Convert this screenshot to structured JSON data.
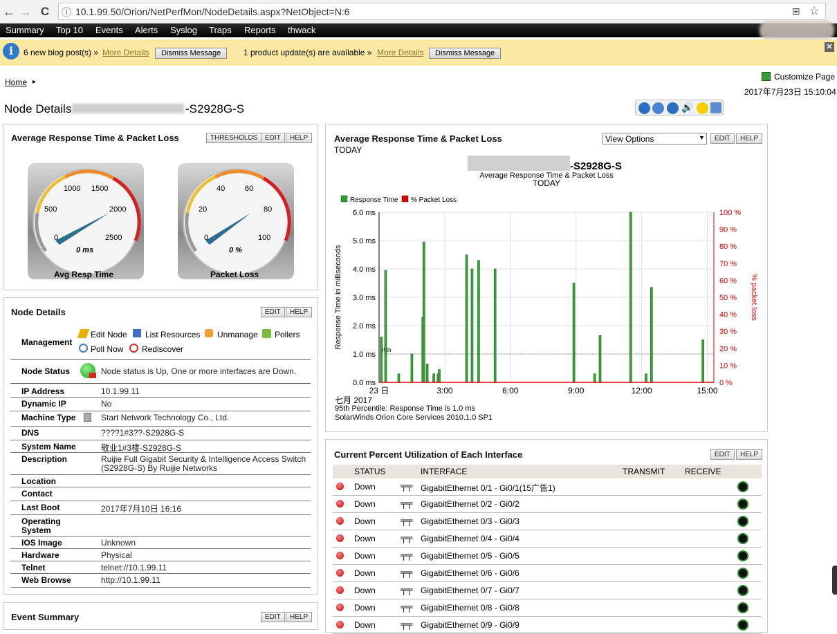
{
  "browser": {
    "url": "10.1.99.50/Orion/NetPerfMon/NodeDetails.aspx?NetObject=N:6",
    "back": "←",
    "forward": "→",
    "reload": "C",
    "info": "ⓘ",
    "star": "☆",
    "translate": "⊞"
  },
  "menu": [
    "Summary",
    "Top 10",
    "Events",
    "Alerts",
    "Syslog",
    "Traps",
    "Reports",
    "thwack"
  ],
  "notice": {
    "blog_text": "6 new blog post(s) »",
    "blog_link": "More Details",
    "dismiss": "Dismiss Message",
    "update_text": "1 product update(s) are available »",
    "update_link": "More Details",
    "close": "✕"
  },
  "header": {
    "home": "Home",
    "arrow": "▸",
    "customize": "Customize Page",
    "datetime": "2017年7月23日 15:10:04",
    "title": "Node Details",
    "title_suffix": "-S2928G-S"
  },
  "gauges_panel": {
    "title": "Average Response Time & Packet Loss",
    "buttons": [
      "THRESHOLDS",
      "EDIT",
      "HELP"
    ],
    "gauges": [
      {
        "caption": "Avg Resp Time",
        "value": "0 ms",
        "ticks": [
          "0",
          "500",
          "1000",
          "1500",
          "2000",
          "2500"
        ]
      },
      {
        "caption": "Packet Loss",
        "value": "0 %",
        "ticks": [
          "0",
          "20",
          "40",
          "60",
          "80",
          "100"
        ]
      }
    ]
  },
  "node_details": {
    "title": "Node Details",
    "buttons": [
      "EDIT",
      "HELP"
    ],
    "management_label": "Management",
    "management": [
      "Edit Node",
      "List Resources",
      "Unmanage",
      "Pollers",
      "Poll Now",
      "Rediscover"
    ],
    "status_label": "Node Status",
    "status": "Node status is Up, One or more interfaces are Down.",
    "rows": [
      {
        "label": "IP Address",
        "value": "10.1.99.11"
      },
      {
        "label": "Dynamic IP",
        "value": "No"
      },
      {
        "label": "Machine Type",
        "value": "Start Network Technology Co., Ltd."
      },
      {
        "label": "DNS",
        "value": "????1#3??-S2928G-S"
      },
      {
        "label": "System Name",
        "value": "敬业1#3楼-S2928G-S"
      },
      {
        "label": "Description",
        "value": "Ruijie Full Gigabit Security & Intelligence Access Switch",
        "value2": "(S2928G-S) By Ruijie Networks"
      },
      {
        "label": "Location",
        "value": ""
      },
      {
        "label": "Contact",
        "value": ""
      },
      {
        "label": "Last Boot",
        "value": "2017年7月10日 16:16"
      },
      {
        "label": "Operating",
        "label2": "System",
        "value": ""
      },
      {
        "label": "IOS Image",
        "value": "Unknown"
      },
      {
        "label": "Hardware",
        "value": "Physical"
      },
      {
        "label": "Telnet",
        "value": "telnet://10.1.99.11"
      },
      {
        "label": "Web Browse",
        "value": "http://10.1.99.11"
      }
    ]
  },
  "event_summary": {
    "title": "Event Summary",
    "buttons": [
      "EDIT",
      "HELP"
    ]
  },
  "chart_panel": {
    "title": "Average Response Time & Packet Loss",
    "subtitle": "TODAY",
    "view_options": "View Options",
    "buttons": [
      "EDIT",
      "HELP"
    ],
    "footer": [
      "七月 2017",
      "95th Percentile: Response Time is 1.0  ms",
      "SolarWinds Orion Core Services 2010.1.0 SP1"
    ]
  },
  "chart_data": {
    "type": "bar",
    "title": "-S2928G-S",
    "subtitle": "Average Response Time & Packet Loss",
    "subtitle2": "TODAY",
    "ylabel": "Response Time in milliseconds",
    "y2label": "% packet loss",
    "ylim": [
      0,
      6
    ],
    "y2lim": [
      0,
      100
    ],
    "yticks": [
      "0.0 ms",
      "1.0 ms",
      "2.0 ms",
      "3.0 ms",
      "4.0 ms",
      "5.0 ms",
      "6.0 ms"
    ],
    "y2ticks": [
      "0 %",
      "10 %",
      "20 %",
      "30 %",
      "40 %",
      "50 %",
      "60 %",
      "70 %",
      "80 %",
      "90 %",
      "100 %"
    ],
    "xlim": [
      0,
      15.3
    ],
    "xticks": [
      {
        "x": 0,
        "label": "23 日"
      },
      {
        "x": 3,
        "label": "3:00"
      },
      {
        "x": 6,
        "label": "6:00"
      },
      {
        "x": 9,
        "label": "9:00"
      },
      {
        "x": 12,
        "label": "12:00"
      },
      {
        "x": 15,
        "label": "15:00"
      }
    ],
    "percentile_label": "95th",
    "percentile_value": 1.0,
    "legend": [
      {
        "name": "Response Time",
        "color": "#2ea12e"
      },
      {
        "name": "% Packet Loss",
        "color": "#e00000"
      }
    ],
    "series": [
      {
        "name": "Response Time",
        "points": [
          [
            0.1,
            1.6
          ],
          [
            0.3,
            3.95
          ],
          [
            0.9,
            0.3
          ],
          [
            1.5,
            1.0
          ],
          [
            2.0,
            2.3
          ],
          [
            2.05,
            4.95
          ],
          [
            2.2,
            0.65
          ],
          [
            2.5,
            0.3
          ],
          [
            2.7,
            0.3
          ],
          [
            2.75,
            0.45
          ],
          [
            4.0,
            4.5
          ],
          [
            4.25,
            4.0
          ],
          [
            4.55,
            4.3
          ],
          [
            5.3,
            4.0
          ],
          [
            8.9,
            3.5
          ],
          [
            9.85,
            0.3
          ],
          [
            10.1,
            1.65
          ],
          [
            11.5,
            6.0
          ],
          [
            12.2,
            0.3
          ],
          [
            12.45,
            3.35
          ],
          [
            14.8,
            1.5
          ]
        ]
      },
      {
        "name": "% Packet Loss",
        "points": [
          [
            0,
            0
          ],
          [
            15.3,
            0
          ]
        ]
      }
    ]
  },
  "iface_panel": {
    "title": "Current Percent Utilization of Each Interface",
    "buttons": [
      "EDIT",
      "HELP"
    ],
    "columns": [
      "STATUS",
      "INTERFACE",
      "TRANSMIT",
      "RECEIVE"
    ],
    "rows": [
      {
        "status": "Down",
        "name": "GigabitEthernet 0/1 - Gi0/1(15广告1)"
      },
      {
        "status": "Down",
        "name": "GigabitEthernet 0/2 - Gi0/2"
      },
      {
        "status": "Down",
        "name": "GigabitEthernet 0/3 - Gi0/3"
      },
      {
        "status": "Down",
        "name": "GigabitEthernet 0/4 - Gi0/4"
      },
      {
        "status": "Down",
        "name": "GigabitEthernet 0/5 - Gi0/5"
      },
      {
        "status": "Down",
        "name": "GigabitEthernet 0/6 - Gi0/6"
      },
      {
        "status": "Down",
        "name": "GigabitEthernet 0/7 - Gi0/7"
      },
      {
        "status": "Down",
        "name": "GigabitEthernet 0/8 - Gi0/8"
      },
      {
        "status": "Down",
        "name": "GigabitEthernet 0/9 - Gi0/9"
      }
    ]
  }
}
